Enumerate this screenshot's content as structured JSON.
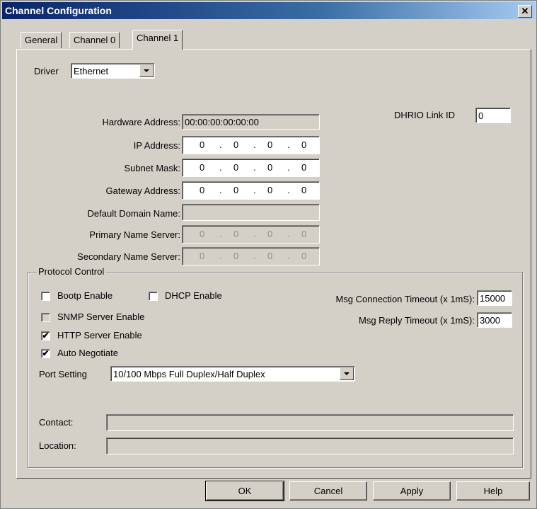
{
  "window": {
    "title": "Channel Configuration",
    "close_glyph": "✕"
  },
  "tabs": [
    {
      "label": "General"
    },
    {
      "label": "Channel 0"
    },
    {
      "label": "Channel 1"
    }
  ],
  "driver": {
    "label": "Driver",
    "value": "Ethernet"
  },
  "dhrio": {
    "label": "DHRIO Link ID",
    "value": "0"
  },
  "network": {
    "hardware_address": {
      "label": "Hardware Address:",
      "value": "00:00:00:00:00:00"
    },
    "ip_address": {
      "label": "IP Address:",
      "octets": [
        "0",
        "0",
        "0",
        "0"
      ]
    },
    "subnet_mask": {
      "label": "Subnet Mask:",
      "octets": [
        "0",
        "0",
        "0",
        "0"
      ]
    },
    "gateway_address": {
      "label": "Gateway Address:",
      "octets": [
        "0",
        "0",
        "0",
        "0"
      ]
    },
    "default_domain": {
      "label": "Default Domain Name:",
      "value": ""
    },
    "primary_dns": {
      "label": "Primary Name Server:",
      "octets": [
        "0",
        "0",
        "0",
        "0"
      ]
    },
    "secondary_dns": {
      "label": "Secondary Name Server:",
      "octets": [
        "0",
        "0",
        "0",
        "0"
      ]
    },
    "dot": "."
  },
  "protocol": {
    "title": "Protocol Control",
    "bootp": {
      "label": "Bootp Enable",
      "checked": false,
      "mark": ""
    },
    "dhcp": {
      "label": "DHCP Enable",
      "checked": false,
      "mark": ""
    },
    "snmp": {
      "label": "SNMP Server Enable",
      "checked": false,
      "mark": ""
    },
    "http": {
      "label": "HTTP Server Enable",
      "checked": true,
      "mark": "✔"
    },
    "autoneg": {
      "label": "Auto Negotiate",
      "checked": true,
      "mark": "✔"
    },
    "msg_conn_timeout": {
      "label": "Msg Connection Timeout (x 1mS):",
      "value": "15000"
    },
    "msg_reply_timeout": {
      "label": "Msg Reply Timeout (x 1mS):",
      "value": "3000"
    },
    "port_setting": {
      "label": "Port Setting",
      "value": "10/100 Mbps Full Duplex/Half Duplex"
    },
    "contact": {
      "label": "Contact:",
      "value": ""
    },
    "location": {
      "label": "Location:",
      "value": ""
    }
  },
  "buttons": {
    "ok": "OK",
    "cancel": "Cancel",
    "apply": "Apply",
    "help": "Help"
  }
}
